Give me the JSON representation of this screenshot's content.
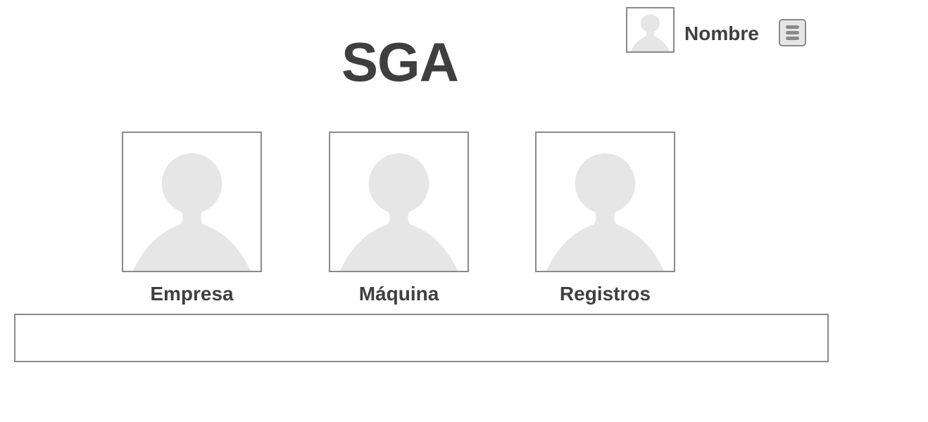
{
  "header": {
    "title": "SGA",
    "user": {
      "name": "Nombre",
      "avatar_icon": "user-placeholder-icon"
    },
    "menu_icon": "hamburger-menu-icon"
  },
  "tiles": [
    {
      "label": "Empresa",
      "icon": "user-placeholder-icon"
    },
    {
      "label": "Máquina",
      "icon": "user-placeholder-icon"
    },
    {
      "label": "Registros",
      "icon": "user-placeholder-icon"
    }
  ],
  "colors": {
    "text": "#3f3f3f",
    "border": "#8a8a8a",
    "placeholder": "#e6e6e6"
  }
}
